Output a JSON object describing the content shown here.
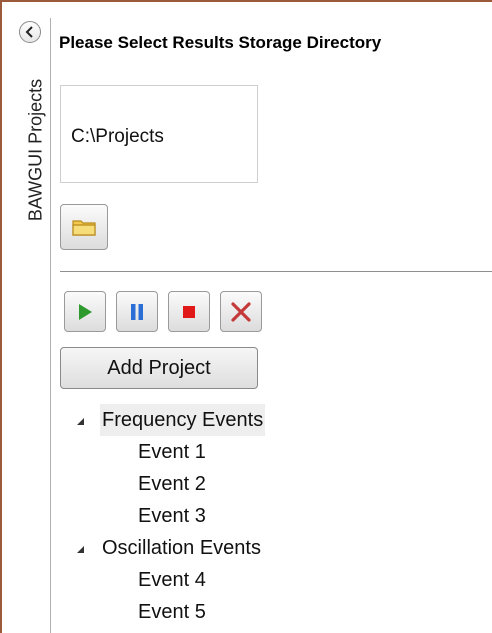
{
  "side_panel": {
    "label": "BAWGUI Projects",
    "collapse_icon": "chevron-left-icon"
  },
  "header": {
    "title": "Please Select Results Storage Directory"
  },
  "directory": {
    "path": "C:\\Projects",
    "browse_icon": "folder-icon"
  },
  "controls": {
    "play_icon": "play-icon",
    "pause_icon": "pause-icon",
    "stop_icon": "stop-icon",
    "cancel_icon": "close-icon",
    "add_project_label": "Add Project"
  },
  "tree": {
    "groups": [
      {
        "label": "Frequency Events",
        "expanded": true,
        "selected": true,
        "children": [
          "Event 1",
          "Event 2",
          "Event 3"
        ]
      },
      {
        "label": "Oscillation Events",
        "expanded": true,
        "selected": false,
        "children": [
          "Event 4",
          "Event 5"
        ]
      }
    ]
  },
  "colors": {
    "frame_border": "#9b5a3a",
    "play_green": "#2e9a2e",
    "pause_blue": "#2b6fd6",
    "stop_red": "#e01818",
    "cancel_red": "#c43a3a",
    "folder_yellow": "#f2c94c"
  }
}
